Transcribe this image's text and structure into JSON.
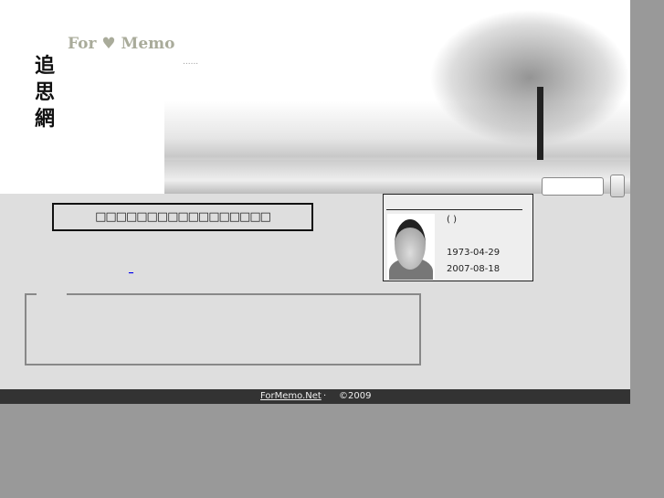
{
  "header": {
    "brand": "For ♥ Memo",
    "title_chars": [
      "追",
      "思",
      "網"
    ],
    "dots": "......"
  },
  "search": {
    "value": "",
    "button_label": ""
  },
  "notice": {
    "text": "□□□□□□□□□□□□□□□□□"
  },
  "link": {
    "text": "_"
  },
  "profile": {
    "name": "( )",
    "birth_date": "1973-04-29",
    "death_date": "2007-08-18"
  },
  "footer": {
    "site": "ForMemo.Net",
    "separator": "·",
    "copyright": "©2009"
  }
}
